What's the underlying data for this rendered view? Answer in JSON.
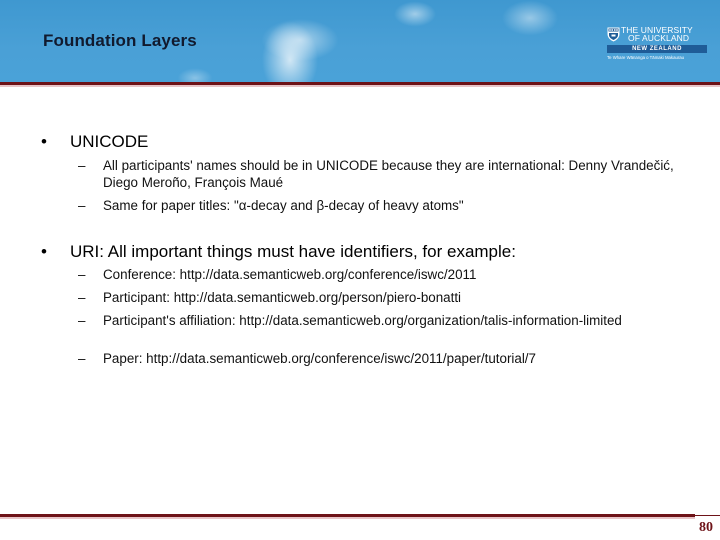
{
  "header": {
    "title": "Foundation Layers",
    "logo": {
      "line1": "THE UNIVERSITY",
      "line2": "OF AUCKLAND",
      "band": "NEW ZEALAND",
      "tagline": "Te Whare Wānanga o Tāmaki Makaurau",
      "crest_icon": "university-crest-icon"
    }
  },
  "colors": {
    "header_sky": "#4aa0d6",
    "rule_dark_red": "#6e1318",
    "rule_pink": "#e8c5c8",
    "logo_band": "#1f5c97"
  },
  "bullets": [
    {
      "symbol": "•",
      "text": "UNICODE",
      "items": [
        {
          "symbol": "–",
          "text": "All participants' names should be in UNICODE because they are international: Denny Vrandečić, Diego Meroño, François Maué"
        },
        {
          "symbol": "–",
          "text": "Same for paper titles: \"α-decay and β-decay of heavy atoms\""
        }
      ]
    },
    {
      "symbol": "•",
      "text": "URI: All important things must have identifiers, for example:",
      "items": [
        {
          "symbol": "–",
          "text": "Conference: http://data.semanticweb.org/conference/iswc/2011"
        },
        {
          "symbol": "–",
          "text": "Participant: http://data.semanticweb.org/person/piero-bonatti"
        },
        {
          "symbol": "–",
          "text": "Participant's affiliation: http://data.semanticweb.org/organization/talis-information-limited"
        },
        {
          "symbol": "–",
          "text": "Paper: http://data.semanticweb.org/conference/iswc/2011/paper/tutorial/7"
        }
      ]
    }
  ],
  "footer": {
    "page_number": "80"
  }
}
